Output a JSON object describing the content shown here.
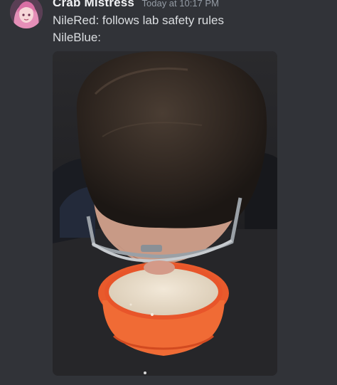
{
  "message": {
    "author": "Crab Mistress",
    "timestamp": "Today at 10:17 PM",
    "lines": [
      "NileRed: follows lab safety rules",
      "NileBlue:"
    ],
    "attachment": {
      "type": "image"
    }
  },
  "colors": {
    "background": "#313338",
    "username": "#f2f3f5",
    "timestamp": "#949ba4",
    "text": "#dbdee1"
  }
}
